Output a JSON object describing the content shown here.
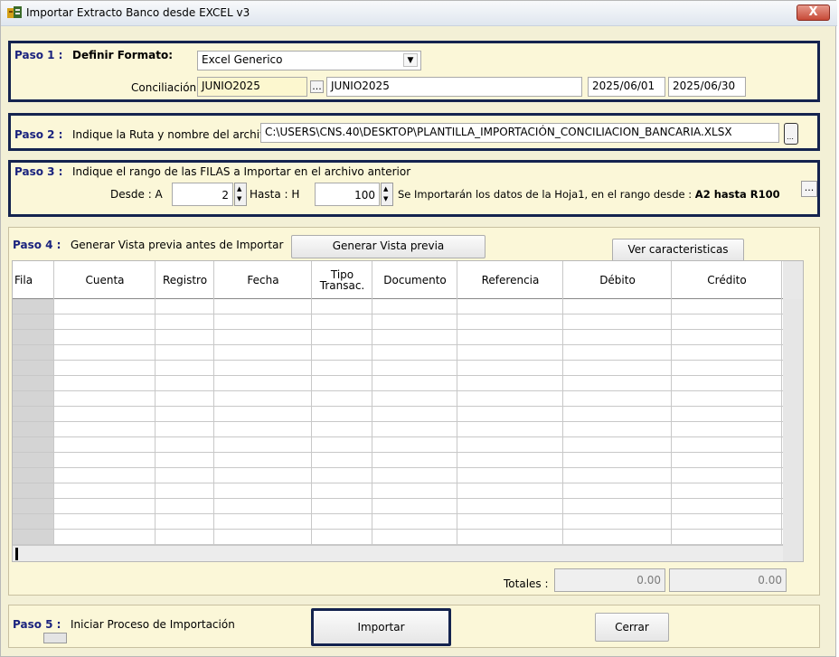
{
  "window": {
    "title": "Importar Extracto Banco desde EXCEL v3",
    "close_symbol": "X"
  },
  "step1": {
    "label": "Paso 1 :",
    "format_label": "Definir Formato:",
    "format_value": "Excel Generico",
    "conciliation_label": "Conciliación :",
    "conciliation_code": "JUNIO2025",
    "browse_label": "...",
    "conciliation_name": "JUNIO2025",
    "date_from": "2025/06/01",
    "date_to": "2025/06/30"
  },
  "step2": {
    "label": "Paso 2 :",
    "instruction": "Indique la Ruta y nombre del archivo",
    "file_path": "C:\\USERS\\CNS.40\\DESKTOP\\PLANTILLA_IMPORTACIÓN_CONCILIACION_BANCARIA.XLSX"
  },
  "step3": {
    "label": "Paso 3 :",
    "instruction": "Indique el rango de las FILAS a Importar en el archivo anterior",
    "from_label": "Desde  :  A",
    "from_value": "2",
    "to_label": "Hasta  :  H",
    "to_value": "100",
    "summary_prefix": "Se Importarán los datos de la Hoja1,  en el rango desde :",
    "summary_range": "A2 hasta R100",
    "more_label": "..."
  },
  "step4": {
    "label": "Paso 4 :",
    "instruction": "Generar Vista previa antes de Importar",
    "preview_button": "Generar Vista previa",
    "features_button": "Ver caracteristicas",
    "columns": [
      "Fila",
      "Cuenta",
      "Registro",
      "Fecha",
      "Tipo Transac.",
      "Documento",
      "Referencia",
      "Débito",
      "Crédito"
    ],
    "row_count": 16,
    "totals_label": "Totales :",
    "total_debit": "0.00",
    "total_credit": "0.00"
  },
  "step5": {
    "label": "Paso 5 :",
    "instruction": "Iniciar Proceso de Importación",
    "import_button": "Importar",
    "close_button": "Cerrar"
  },
  "colors": {
    "panel_border_dark": "#14234f",
    "panel_bg": "#fbf7d8",
    "window_bg": "#f3f0d6"
  }
}
